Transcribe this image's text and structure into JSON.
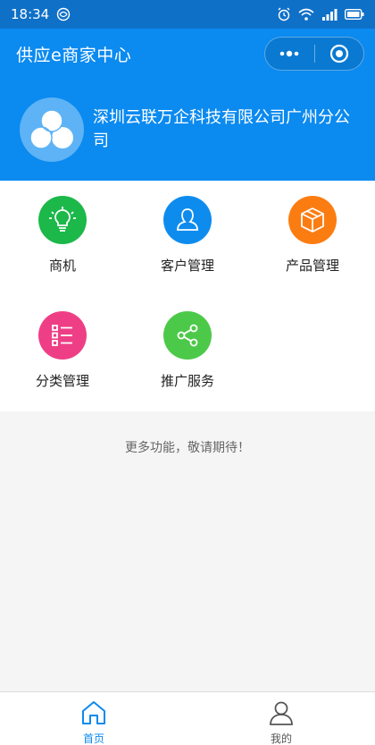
{
  "status_bar": {
    "time": "18:34",
    "icons": [
      "sim-icon",
      "alarm-icon",
      "wifi-icon",
      "signal-icon",
      "battery-icon"
    ]
  },
  "nav": {
    "title": "供应e商家中心",
    "capsule_icons": [
      "more-dots-icon",
      "close-target-icon"
    ]
  },
  "company": {
    "name": "深圳云联万企科技有限公司广州分公司",
    "logo_icon": "three-circles-logo-icon"
  },
  "grid": {
    "items": [
      {
        "label": "商机",
        "icon": "lightbulb-icon",
        "color": "#1cb84a"
      },
      {
        "label": "客户管理",
        "icon": "person-icon",
        "color": "#0e8cee"
      },
      {
        "label": "产品管理",
        "icon": "box-icon",
        "color": "#fb7d12"
      },
      {
        "label": "分类管理",
        "icon": "list-icon",
        "color": "#ee3f86"
      },
      {
        "label": "推广服务",
        "icon": "share-icon",
        "color": "#4dc94a"
      }
    ]
  },
  "more_text": "更多功能，敬请期待！",
  "tab_bar": {
    "tabs": [
      {
        "label": "首页",
        "icon": "home-icon",
        "active": true
      },
      {
        "label": "我的",
        "icon": "user-icon",
        "active": false
      }
    ],
    "active_color": "#0b8af0",
    "inactive_color": "#555555"
  },
  "colors": {
    "primary": "#0b8af0",
    "status_bar": "#0f70c8",
    "background": "#f5f5f5"
  }
}
